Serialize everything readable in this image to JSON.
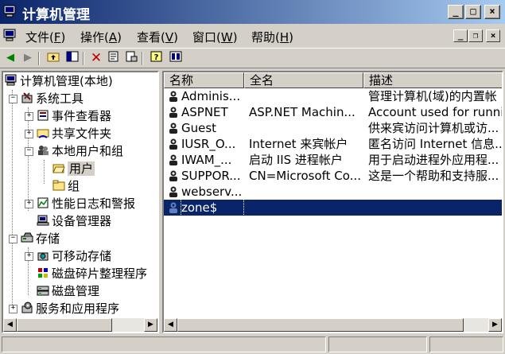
{
  "window": {
    "title": "计算机管理"
  },
  "caption_buttons": {
    "minimize": "_",
    "maximize": "□",
    "close": "×"
  },
  "menu": [
    {
      "label": "文件",
      "key": "F"
    },
    {
      "label": "操作",
      "key": "A"
    },
    {
      "label": "查看",
      "key": "V"
    },
    {
      "label": "窗口",
      "key": "W"
    },
    {
      "label": "帮助",
      "key": "H"
    }
  ],
  "tree": {
    "root": "计算机管理(本地)",
    "system_tools": "系统工具",
    "event_viewer": "事件查看器",
    "shared_folders": "共享文件夹",
    "local_users_groups": "本地用户和组",
    "users": "用户",
    "groups": "组",
    "perf_logs": "性能日志和警报",
    "device_manager": "设备管理器",
    "storage": "存储",
    "removable_storage": "可移动存储",
    "defrag": "磁盘碎片整理程序",
    "disk_management": "磁盘管理",
    "services_apps": "服务和应用程序"
  },
  "list": {
    "columns": [
      "名称",
      "全名",
      "描述"
    ],
    "rows": [
      {
        "name": "Adminis...",
        "fullname": "",
        "desc": "管理计算机(域)的内置帐"
      },
      {
        "name": "ASPNET",
        "fullname": "ASP.NET Machin...",
        "desc": "Account used for runnin"
      },
      {
        "name": "Guest",
        "fullname": "",
        "desc": "供来宾访问计算机或访..."
      },
      {
        "name": "IUSR_O...",
        "fullname": "Internet 来宾帐户",
        "desc": "匿名访问 Internet 信息..."
      },
      {
        "name": "IWAM_...",
        "fullname": "启动 IIS 进程帐户",
        "desc": "用于启动进程外应用程..."
      },
      {
        "name": "SUPPOR...",
        "fullname": "CN=Microsoft Co...",
        "desc": "这是一个帮助和支持服..."
      },
      {
        "name": "webserv...",
        "fullname": "",
        "desc": ""
      },
      {
        "name": "zone$",
        "fullname": "",
        "desc": ""
      }
    ]
  }
}
